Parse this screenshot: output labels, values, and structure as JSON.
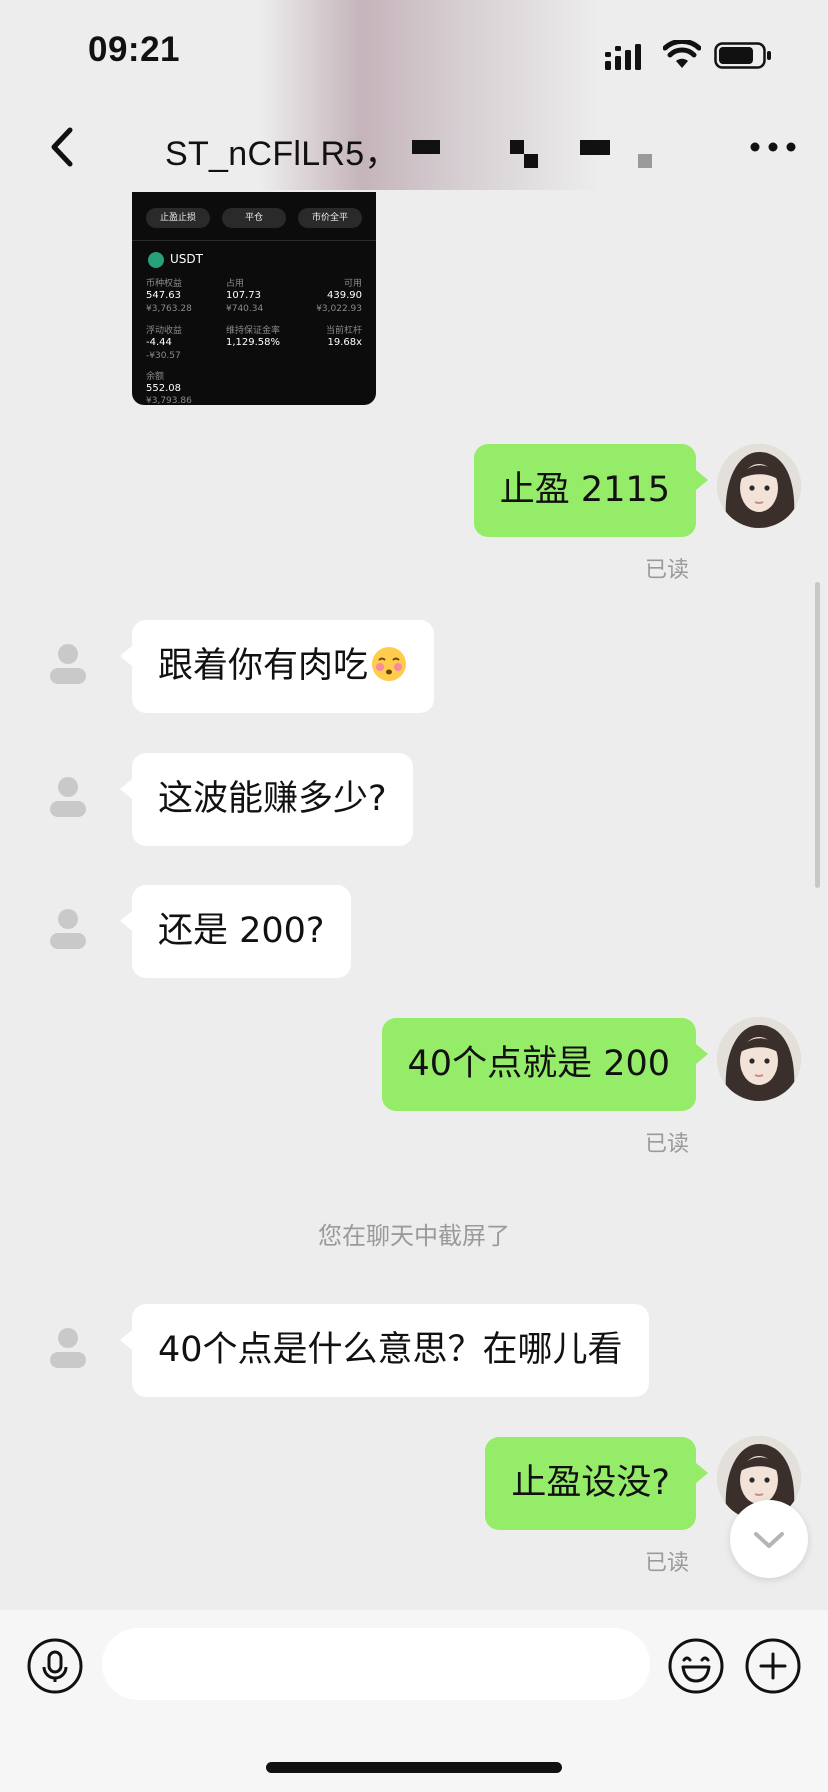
{
  "status_bar": {
    "time": "09:21"
  },
  "header": {
    "title": "ST_nCFlLR5，"
  },
  "screenshot_card": {
    "buttons": [
      "止盈止损",
      "平仓",
      "市价全平"
    ],
    "coin": "USDT",
    "cells": [
      {
        "label": "币种权益",
        "value": "547.63",
        "sub": "¥3,763.28"
      },
      {
        "label": "占用",
        "value": "107.73",
        "sub": "¥740.34"
      },
      {
        "label": "可用",
        "value": "439.90",
        "sub": "¥3,022.93"
      },
      {
        "label": "浮动收益",
        "value": "-4.44",
        "sub": "-¥30.57"
      },
      {
        "label": "维持保证金率",
        "value": "1,129.58%",
        "sub": ""
      },
      {
        "label": "当前杠杆",
        "value": "19.68x",
        "sub": ""
      },
      {
        "label": "余额",
        "value": "552.08",
        "sub": "¥3,793.86"
      }
    ]
  },
  "messages": [
    {
      "from": "me",
      "text": "止盈 2115",
      "status": "已读"
    },
    {
      "from": "other",
      "text": "跟着你有肉吃",
      "emoji": "shy-face-emoji"
    },
    {
      "from": "other",
      "text": "这波能赚多少?"
    },
    {
      "from": "other",
      "text": "还是 200?"
    },
    {
      "from": "me",
      "text": "40个点就是 200",
      "status": "已读"
    },
    {
      "from": "system",
      "text": "您在聊天中截屏了"
    },
    {
      "from": "other",
      "text": "40个点是什么意思？在哪儿看"
    },
    {
      "from": "me",
      "text": "止盈设没?",
      "status": "已读"
    }
  ],
  "input_bar": {
    "placeholder": ""
  },
  "colors": {
    "bubble_me": "#95ec69",
    "bubble_other": "#ffffff",
    "background": "#ededed"
  }
}
